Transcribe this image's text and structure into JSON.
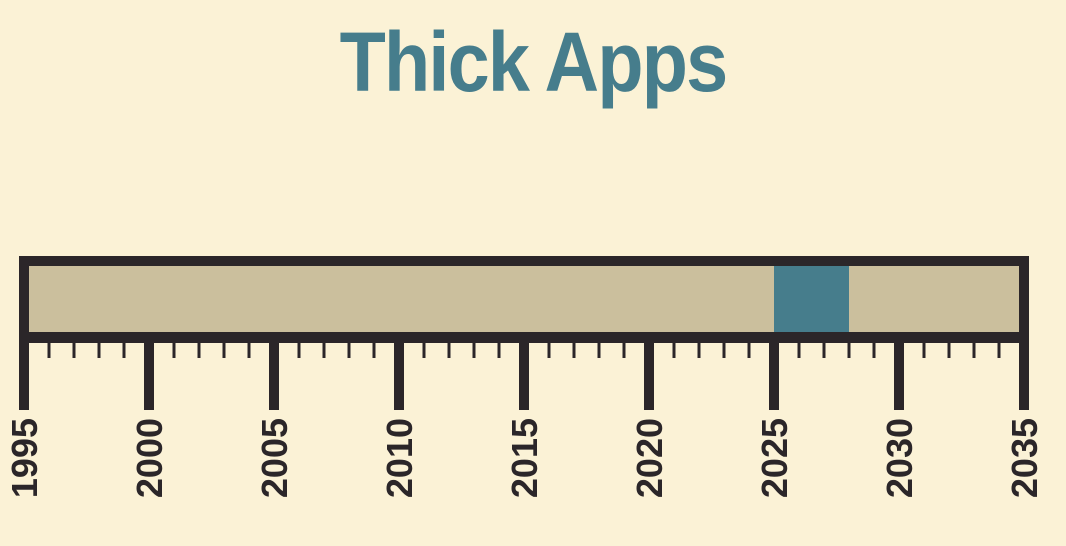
{
  "title": "Thick Apps",
  "colors": {
    "background": "#fbf2d6",
    "bar": "#cbbf9d",
    "frame": "#2b2629",
    "highlight": "#467d8c",
    "title": "#467d8c"
  },
  "chart_data": {
    "type": "bar",
    "title": "Thick Apps",
    "xlabel": "",
    "ylabel": "",
    "xlim": [
      1995,
      2035
    ],
    "major_ticks": [
      1995,
      2000,
      2005,
      2010,
      2015,
      2020,
      2025,
      2030,
      2035
    ],
    "tick_labels": [
      "1995",
      "2000",
      "2005",
      "2010",
      "2015",
      "2020",
      "2025",
      "2030",
      "2035"
    ],
    "minor_tick_interval": 1,
    "range_bar": {
      "start": 1995,
      "end": 2035
    },
    "highlight": {
      "start": 2025,
      "end": 2028
    },
    "grid": false,
    "legend": "none"
  }
}
